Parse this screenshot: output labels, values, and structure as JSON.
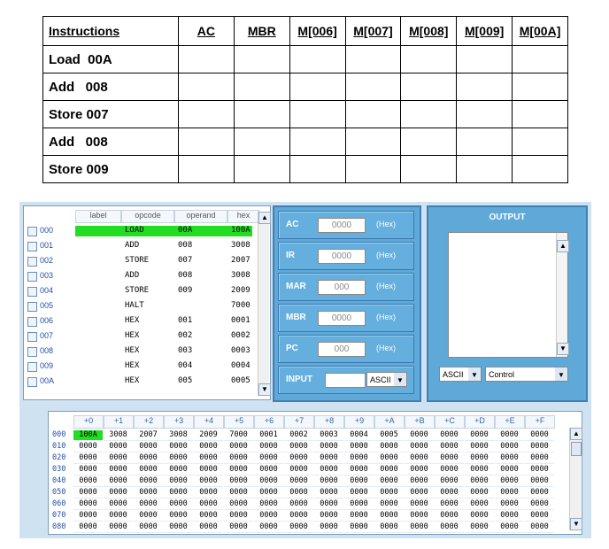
{
  "instructions_table": {
    "headers": [
      "Instructions",
      "AC",
      "MBR",
      "M[006]",
      "M[007]",
      "M[008]",
      "M[009]",
      "M[00A]"
    ],
    "rows": [
      "Load  00A",
      "Add   008",
      "Store 007",
      "Add   008",
      "Store 009"
    ]
  },
  "memory_list": {
    "headers": [
      "label",
      "opcode",
      "operand",
      "hex"
    ],
    "rows": [
      {
        "addr": "000",
        "label": "",
        "opcode": "LOAD",
        "operand": "00A",
        "hex": "100A",
        "selected": true
      },
      {
        "addr": "001",
        "label": "",
        "opcode": "ADD",
        "operand": "008",
        "hex": "3008"
      },
      {
        "addr": "002",
        "label": "",
        "opcode": "STORE",
        "operand": "007",
        "hex": "2007"
      },
      {
        "addr": "003",
        "label": "",
        "opcode": "ADD",
        "operand": "008",
        "hex": "3008"
      },
      {
        "addr": "004",
        "label": "",
        "opcode": "STORE",
        "operand": "009",
        "hex": "2009"
      },
      {
        "addr": "005",
        "label": "",
        "opcode": "HALT",
        "operand": "",
        "hex": "7000"
      },
      {
        "addr": "006",
        "label": "",
        "opcode": "HEX",
        "operand": "001",
        "hex": "0001"
      },
      {
        "addr": "007",
        "label": "",
        "opcode": "HEX",
        "operand": "002",
        "hex": "0002"
      },
      {
        "addr": "008",
        "label": "",
        "opcode": "HEX",
        "operand": "003",
        "hex": "0003"
      },
      {
        "addr": "009",
        "label": "",
        "opcode": "HEX",
        "operand": "004",
        "hex": "0004"
      },
      {
        "addr": "00A",
        "label": "",
        "opcode": "HEX",
        "operand": "005",
        "hex": "0005"
      }
    ]
  },
  "registers": [
    {
      "name": "AC",
      "value": "0000",
      "unit": "(Hex)"
    },
    {
      "name": "IR",
      "value": "0000",
      "unit": "(Hex)"
    },
    {
      "name": "MAR",
      "value": "000",
      "unit": "(Hex)"
    },
    {
      "name": "MBR",
      "value": "0000",
      "unit": "(Hex)"
    },
    {
      "name": "PC",
      "value": "000",
      "unit": "(Hex)"
    }
  ],
  "input": {
    "label": "INPUT",
    "mode": "ASCII"
  },
  "output": {
    "title": "OUTPUT",
    "format": "ASCII",
    "control": "Control"
  },
  "hex_dump": {
    "columns": [
      "+0",
      "+1",
      "+2",
      "+3",
      "+4",
      "+5",
      "+6",
      "+7",
      "+8",
      "+9",
      "+A",
      "+B",
      "+C",
      "+D",
      "+E",
      "+F"
    ],
    "rows": [
      {
        "addr": "000",
        "cells": [
          "100A",
          "3008",
          "2007",
          "3008",
          "2009",
          "7000",
          "0001",
          "0002",
          "0003",
          "0004",
          "0005",
          "0000",
          "0000",
          "0000",
          "0000",
          "0000"
        ]
      },
      {
        "addr": "010",
        "cells": [
          "0000",
          "0000",
          "0000",
          "0000",
          "0000",
          "0000",
          "0000",
          "0000",
          "0000",
          "0000",
          "0000",
          "0000",
          "0000",
          "0000",
          "0000",
          "0000"
        ]
      },
      {
        "addr": "020",
        "cells": [
          "0000",
          "0000",
          "0000",
          "0000",
          "0000",
          "0000",
          "0000",
          "0000",
          "0000",
          "0000",
          "0000",
          "0000",
          "0000",
          "0000",
          "0000",
          "0000"
        ]
      },
      {
        "addr": "030",
        "cells": [
          "0000",
          "0000",
          "0000",
          "0000",
          "0000",
          "0000",
          "0000",
          "0000",
          "0000",
          "0000",
          "0000",
          "0000",
          "0000",
          "0000",
          "0000",
          "0000"
        ]
      },
      {
        "addr": "040",
        "cells": [
          "0000",
          "0000",
          "0000",
          "0000",
          "0000",
          "0000",
          "0000",
          "0000",
          "0000",
          "0000",
          "0000",
          "0000",
          "0000",
          "0000",
          "0000",
          "0000"
        ]
      },
      {
        "addr": "050",
        "cells": [
          "0000",
          "0000",
          "0000",
          "0000",
          "0000",
          "0000",
          "0000",
          "0000",
          "0000",
          "0000",
          "0000",
          "0000",
          "0000",
          "0000",
          "0000",
          "0000"
        ]
      },
      {
        "addr": "060",
        "cells": [
          "0000",
          "0000",
          "0000",
          "0000",
          "0000",
          "0000",
          "0000",
          "0000",
          "0000",
          "0000",
          "0000",
          "0000",
          "0000",
          "0000",
          "0000",
          "0000"
        ]
      },
      {
        "addr": "070",
        "cells": [
          "0000",
          "0000",
          "0000",
          "0000",
          "0000",
          "0000",
          "0000",
          "0000",
          "0000",
          "0000",
          "0000",
          "0000",
          "0000",
          "0000",
          "0000",
          "0000"
        ]
      },
      {
        "addr": "080",
        "cells": [
          "0000",
          "0000",
          "0000",
          "0000",
          "0000",
          "0000",
          "0000",
          "0000",
          "0000",
          "0000",
          "0000",
          "0000",
          "0000",
          "0000",
          "0000",
          "0000"
        ]
      }
    ],
    "highlight_cell": "100A"
  },
  "colors": {
    "highlight": "#22dd22",
    "panel": "#5ea9d8",
    "frame": "#cfe2f2"
  }
}
